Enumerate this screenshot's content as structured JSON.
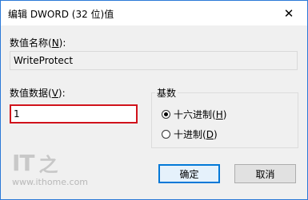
{
  "window": {
    "title": "编辑 DWORD (32 位)值",
    "close_glyph": "✕"
  },
  "value_name": {
    "label_prefix": "数值名称(",
    "mnemonic": "N",
    "label_suffix": "):",
    "value": "WriteProtect"
  },
  "value_data": {
    "label_prefix": "数值数据(",
    "mnemonic": "V",
    "label_suffix": "):",
    "value": "1",
    "highlight_color": "#d0121b"
  },
  "base": {
    "title": "基数",
    "options": [
      {
        "prefix": "十六进制(",
        "mnemonic": "H",
        "suffix": ")",
        "selected": true
      },
      {
        "prefix": "十进制(",
        "mnemonic": "D",
        "suffix": ")",
        "selected": false
      }
    ]
  },
  "buttons": {
    "ok": "确定",
    "cancel": "取消"
  },
  "watermark": {
    "logo_text": "IT",
    "logo_glyph": "之",
    "url": "www.ithome.com"
  }
}
